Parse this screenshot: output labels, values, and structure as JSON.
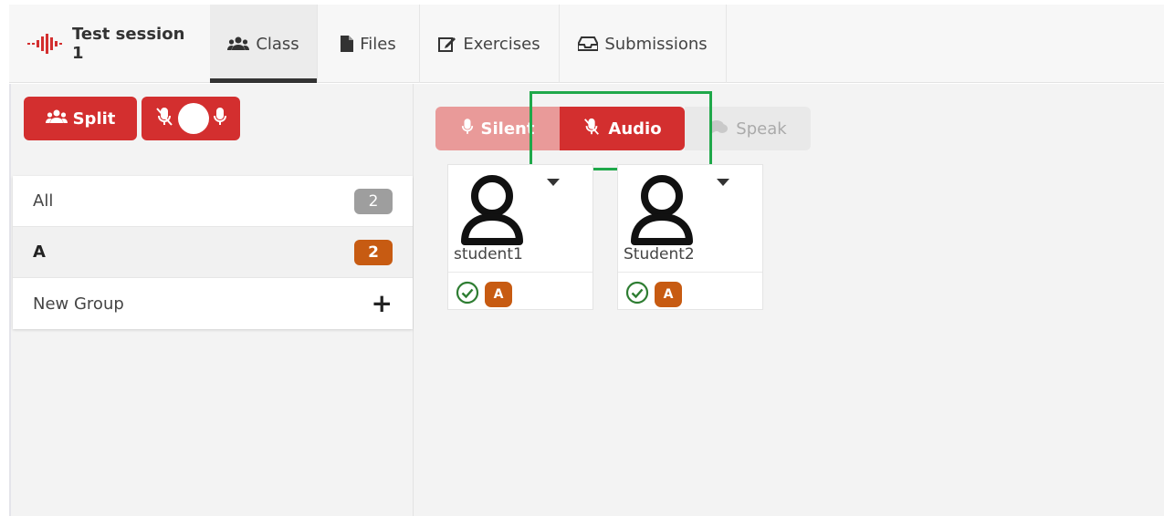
{
  "nav": {
    "brand_label": "Test session 1",
    "tabs": [
      {
        "label": "Class",
        "icon": "group-icon"
      },
      {
        "label": "Files",
        "icon": "file-icon"
      },
      {
        "label": "Exercises",
        "icon": "edit-icon"
      },
      {
        "label": "Submissions",
        "icon": "inbox-icon"
      }
    ]
  },
  "controls": {
    "split_label": "Split"
  },
  "groups": [
    {
      "label": "All",
      "count": "2"
    },
    {
      "label": "A",
      "count": "2"
    },
    {
      "label": "New Group"
    }
  ],
  "modes": {
    "silent_label": "Silent",
    "audio_label": "Audio",
    "speak_label": "Speak",
    "selected": "Audio"
  },
  "students": [
    {
      "name": "student1",
      "group_badge": "A"
    },
    {
      "name": "Student2",
      "group_badge": "A"
    }
  ],
  "colors": {
    "accent_red": "#d32f2f",
    "badge_orange": "#c75b12",
    "highlight_green": "#1fa84a",
    "check_green": "#2e7d32"
  }
}
